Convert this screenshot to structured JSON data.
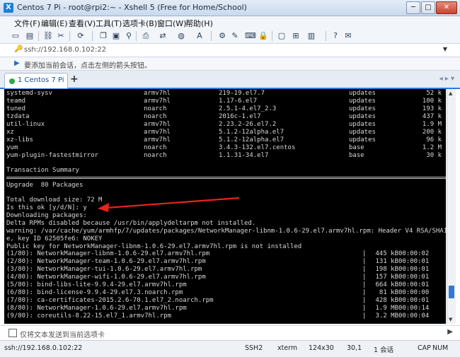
{
  "window": {
    "title": "Centos 7  Pi - root@rpi2:~ - Xshell 5 (Free for Home/School)",
    "minimize": "─",
    "maximize": "□",
    "close": "✕"
  },
  "menu": {
    "items": [
      "文件(F)",
      "编辑(E)",
      "查看(V)",
      "工具(T)",
      "选项卡(B)",
      "窗口(W)",
      "帮助(H)"
    ]
  },
  "address": {
    "value": "ssh://192.168.0.102:22"
  },
  "hint": {
    "text": "要添加当前会话，点击左侧的箭头按钮。"
  },
  "tabs": [
    {
      "label": "1 Centos 7  Pi",
      "status_color": "#2fa84a"
    }
  ],
  "terminal": {
    "packages": [
      {
        "name": "systemd-sysv",
        "arch": "armv7hl",
        "version": "219-19.el7.7",
        "repo": "updates",
        "size": "52 k"
      },
      {
        "name": "teamd",
        "arch": "armv7hl",
        "version": "1.17-6.el7",
        "repo": "updates",
        "size": "100 k"
      },
      {
        "name": "tuned",
        "arch": "noarch",
        "version": "2.5.1-4.el7_2.3",
        "repo": "updates",
        "size": "193 k"
      },
      {
        "name": "tzdata",
        "arch": "noarch",
        "version": "2016c-1.el7",
        "repo": "updates",
        "size": "437 k"
      },
      {
        "name": "util-linux",
        "arch": "armv7hl",
        "version": "2.23.2-26.el7.2",
        "repo": "updates",
        "size": "1.9 M"
      },
      {
        "name": "xz",
        "arch": "armv7hl",
        "version": "5.1.2-12alpha.el7",
        "repo": "updates",
        "size": "200 k"
      },
      {
        "name": "xz-libs",
        "arch": "armv7hl",
        "version": "5.1.2-12alpha.el7",
        "repo": "updates",
        "size": "96 k"
      },
      {
        "name": "yum",
        "arch": "noarch",
        "version": "3.4.3-132.el7.centos",
        "repo": "base",
        "size": "1.2 M"
      },
      {
        "name": "yum-plugin-fastestmirror",
        "arch": "noarch",
        "version": "1.1.31-34.el7",
        "repo": "base",
        "size": "30 k"
      }
    ],
    "summary_title": "Transaction Summary",
    "upgrade_line": "Upgrade  80 Packages",
    "download_size": "Total download size: 72 M",
    "prompt": "Is this ok [y/d/N]: y",
    "downloading": "Downloading packages:",
    "delta": "Delta RPMs disabled because /usr/bin/applydeltarpm not installed.",
    "warning1": "warning: /var/cache/yum/armhfp/7/updates/packages/NetworkManager-libnm-1.0.6-29.el7.armv7hl.rpm: Header V4 RSA/SHA1 Signatur",
    "warning2": "e, key ID 62505fe6: NOKEY",
    "pubkey": "Public key for NetworkManager-libnm-1.0.6-29.el7.armv7hl.rpm is not installed",
    "downloads": [
      {
        "file": "(1/80): NetworkManager-libnm-1.0.6-29.el7.armv7hl.rpm",
        "size": "445 kB",
        "time": "00:00:02"
      },
      {
        "file": "(2/80): NetworkManager-team-1.0.6-29.el7.armv7hl.rpm",
        "size": "131 kB",
        "time": "00:00:01"
      },
      {
        "file": "(3/80): NetworkManager-tui-1.0.6-29.el7.armv7hl.rpm",
        "size": "198 kB",
        "time": "00:00:01"
      },
      {
        "file": "(4/80): NetworkManager-wifi-1.0.6-29.el7.armv7hl.rpm",
        "size": "157 kB",
        "time": "00:00:01"
      },
      {
        "file": "(5/80): bind-libs-lite-9.9.4-29.el7.armv7hl.rpm",
        "size": "664 kB",
        "time": "00:00:01"
      },
      {
        "file": "(6/80): bind-license-9.9.4-29.el7.3.noarch.rpm",
        "size": "81 kB",
        "time": "00:00:00"
      },
      {
        "file": "(7/80): ca-certificates-2015.2.6-70.1.el7_2.noarch.rpm",
        "size": "428 kB",
        "time": "00:00:01"
      },
      {
        "file": "(8/80): NetworkManager-1.0.6-29.el7.armv7hl.rpm",
        "size": "1.9 MB",
        "time": "00:00:14"
      },
      {
        "file": "(9/80): coreutils-8.22-15.el7_1.armv7hl.rpm",
        "size": "3.2 MB",
        "time": "00:00:04"
      }
    ],
    "annotation_color": "#e8231c"
  },
  "sendbar": {
    "text": "仅将文本发送到当前选项卡"
  },
  "status": {
    "address": "ssh://192.168.0.102:22",
    "protocol": "SSH2",
    "terminal": "xterm",
    "size": "124x30",
    "position": "30,1",
    "sessions": "1 会话",
    "caps": "CAP",
    "num": "NUM"
  }
}
